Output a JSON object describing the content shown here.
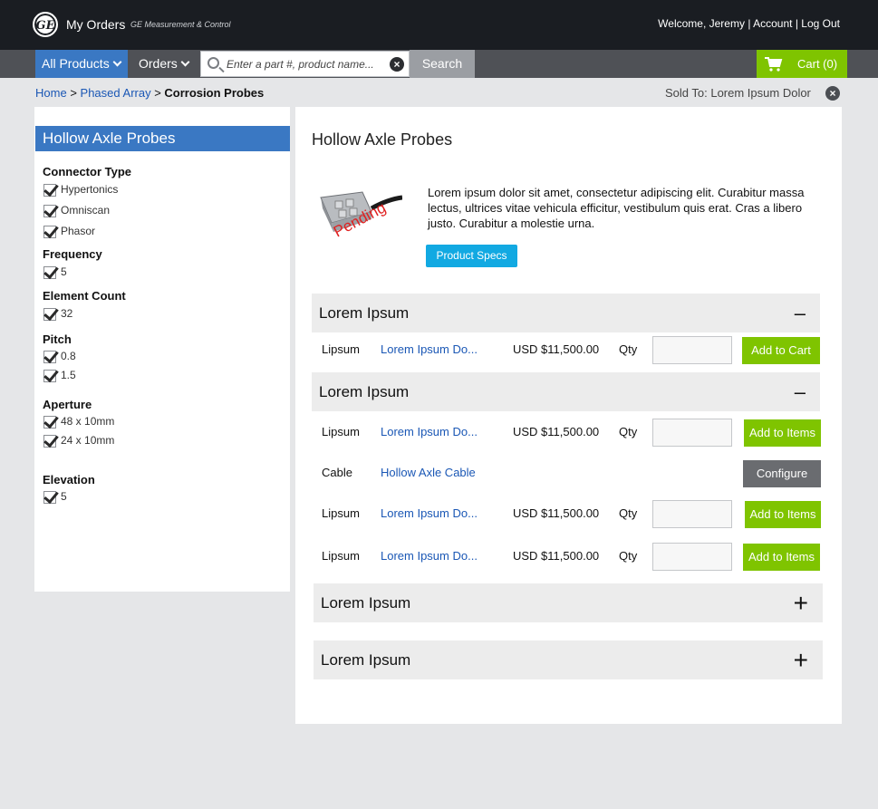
{
  "header": {
    "logo_text": "GE",
    "title": "My Orders",
    "subtitle": "GE Measurement & Control",
    "welcome": "Welcome, Jeremy",
    "account": "Account",
    "logout": "Log Out",
    "sep": "|"
  },
  "nav": {
    "all_products": "All Products",
    "orders": "Orders",
    "search_placeholder": "Enter a part #, product name...",
    "search_button": "Search",
    "cart_label": "Cart (0)"
  },
  "breadcrumb": {
    "home": "Home",
    "sep": ">",
    "phased": "Phased Array",
    "current": "Corrosion Probes",
    "sold_to": "Sold To: Lorem Ipsum Dolor"
  },
  "filters": {
    "title": "Hollow Axle Probes",
    "groups": [
      {
        "name": "Connector Type",
        "options": [
          "Hypertonics",
          "Omniscan",
          "Phasor"
        ]
      },
      {
        "name": "Frequency",
        "options": [
          "5"
        ]
      },
      {
        "name": "Element Count",
        "options": [
          "32"
        ]
      },
      {
        "name": "Pitch",
        "options": [
          "0.8",
          "1.5"
        ]
      },
      {
        "name": "Aperture",
        "options": [
          "48 x 10mm",
          "24 x 10mm"
        ]
      },
      {
        "name": "Elevation",
        "options": [
          "5"
        ]
      }
    ]
  },
  "product": {
    "title": "Hollow Axle Probes",
    "description": "Lorem ipsum dolor sit amet, consectetur adipiscing elit. Curabitur massa lectus, ultrices vitae vehicula efficitur, vestibulum quis erat. Cras a libero justo. Curabitur a molestie urna.",
    "specs_button": "Product Specs",
    "image_overlay": "Pending"
  },
  "sections": [
    {
      "title": "Lorem Ipsum",
      "toggle": "–",
      "rows": [
        {
          "type": "Lipsum",
          "link": "Lorem Ipsum Do...",
          "price": "USD $11,500.00",
          "qty_label": "Qty",
          "qty_value": "",
          "button": "Add to Cart"
        }
      ]
    },
    {
      "title": "Lorem Ipsum",
      "toggle": "–",
      "rows": [
        {
          "type": "Lipsum",
          "link": "Lorem Ipsum Do...",
          "price": "USD $11,500.00",
          "qty_label": "Qty",
          "qty_value": "",
          "button": "Add to Items"
        },
        {
          "type": "Cable",
          "link": "Hollow Axle Cable",
          "button": "Configure"
        },
        {
          "type": "Lipsum",
          "link": "Lorem Ipsum Do...",
          "price": "USD $11,500.00",
          "qty_label": "Qty",
          "qty_value": "",
          "button": "Add to Items"
        },
        {
          "type": "Lipsum",
          "link": "Lorem Ipsum Do...",
          "price": "USD $11,500.00",
          "qty_label": "Qty",
          "qty_value": "",
          "button": "Add to Items"
        }
      ]
    },
    {
      "title": "Lorem Ipsum",
      "toggle": "+"
    },
    {
      "title": "Lorem Ipsum",
      "toggle": "+"
    }
  ],
  "colors": {
    "header_bg": "#1a1d22",
    "nav_bg": "#4f5156",
    "accent_blue": "#3a78c3",
    "link_blue": "#1a57b5",
    "green": "#7fc400",
    "specs_blue": "#12a9e2",
    "page_bg": "#e5e6e8"
  },
  "icons": [
    "ge-logo-icon",
    "chevron-down-icon",
    "search-icon",
    "clear-icon",
    "cart-icon",
    "close-icon",
    "checkbox-checked-icon"
  ]
}
